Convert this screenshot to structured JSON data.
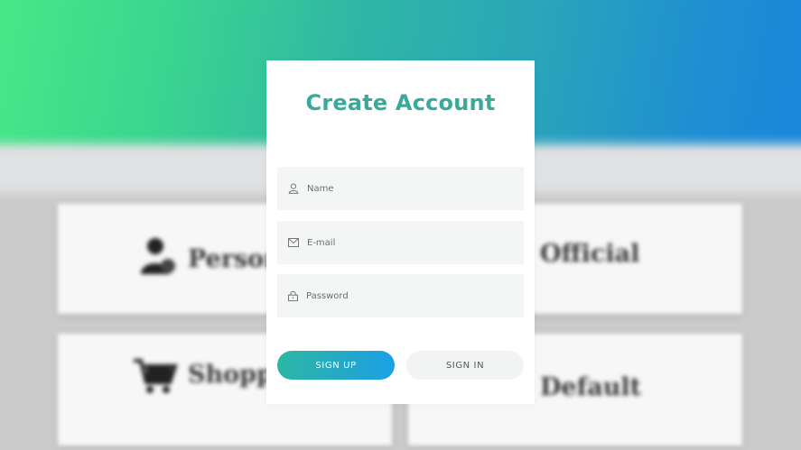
{
  "background": {
    "cards": [
      {
        "label": "Personal",
        "icon": "person-icon"
      },
      {
        "label": "Official",
        "icon": null
      },
      {
        "label": "Shopping",
        "icon": "cart-icon"
      },
      {
        "label": "Default",
        "icon": null
      }
    ]
  },
  "dialog": {
    "title": "Create Account",
    "fields": {
      "name": {
        "placeholder": "Name",
        "value": "",
        "icon": "user-icon"
      },
      "email": {
        "placeholder": "E-mail",
        "value": "",
        "icon": "envelope-icon"
      },
      "password": {
        "placeholder": "Password",
        "value": "",
        "icon": "lock-icon"
      }
    },
    "buttons": {
      "signup_label": "SIGN UP",
      "signin_label": "SIGN IN"
    }
  },
  "colors": {
    "title": "#3aa99a",
    "signup_gradient_start": "#2bb7a5",
    "signup_gradient_end": "#1ba0e8",
    "field_background": "#f3f6f5",
    "banner_left": "#49ea87",
    "banner_right": "#1a86dc"
  }
}
